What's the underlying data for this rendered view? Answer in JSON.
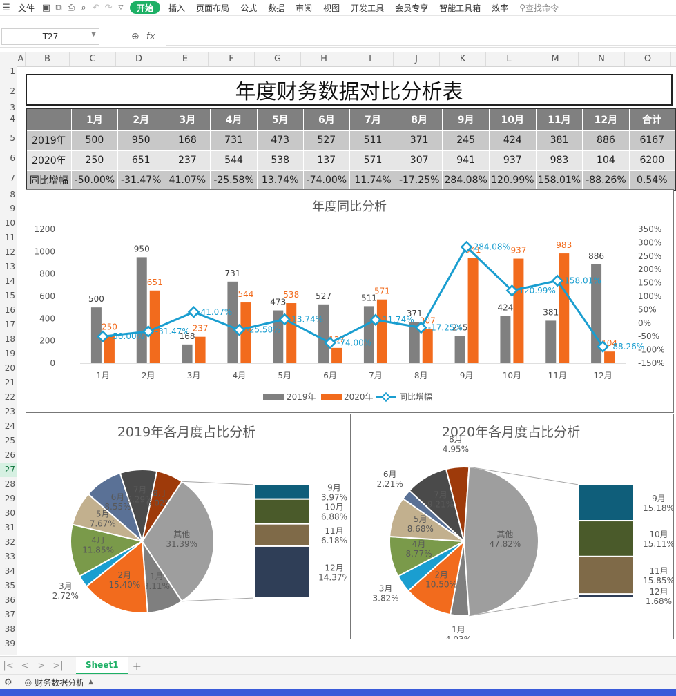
{
  "toolbar": {
    "menu_icon": "hamburger-icon",
    "file_label": "文件",
    "tabs": [
      "开始",
      "插入",
      "页面布局",
      "公式",
      "数据",
      "审阅",
      "视图",
      "开发工具",
      "会员专享",
      "智能工具箱",
      "效率"
    ],
    "active_tab": "开始",
    "search_placeholder": "查找命令"
  },
  "formula_bar": {
    "cell_ref": "T27",
    "fx": "fx",
    "value": ""
  },
  "columns": [
    "A",
    "B",
    "C",
    "D",
    "E",
    "F",
    "G",
    "H",
    "I",
    "J",
    "K",
    "L",
    "M",
    "N",
    "O"
  ],
  "rows": [
    "1",
    "2",
    "3",
    "4",
    "5",
    "6",
    "7",
    "8",
    "9",
    "10",
    "11",
    "12",
    "13",
    "14",
    "15",
    "16",
    "17",
    "18",
    "19",
    "20",
    "21",
    "22",
    "23",
    "24",
    "25",
    "26",
    "27",
    "28",
    "29",
    "30",
    "31",
    "32",
    "33",
    "34",
    "35",
    "36",
    "37",
    "38",
    "39"
  ],
  "active_row": "27",
  "sheet_title": "年度财务数据对比分析表",
  "table": {
    "header": [
      "",
      "1月",
      "2月",
      "3月",
      "4月",
      "5月",
      "6月",
      "7月",
      "8月",
      "9月",
      "10月",
      "11月",
      "12月",
      "合计"
    ],
    "rows": [
      [
        "2019年",
        "500",
        "950",
        "168",
        "731",
        "473",
        "527",
        "511",
        "371",
        "245",
        "424",
        "381",
        "886",
        "6167"
      ],
      [
        "2020年",
        "250",
        "651",
        "237",
        "544",
        "538",
        "137",
        "571",
        "307",
        "941",
        "937",
        "983",
        "104",
        "6200"
      ],
      [
        "同比增幅",
        "-50.00%",
        "-31.47%",
        "41.07%",
        "-25.58%",
        "13.74%",
        "-74.00%",
        "11.74%",
        "-17.25%",
        "284.08%",
        "120.99%",
        "158.01%",
        "-88.26%",
        "0.54%"
      ]
    ]
  },
  "chart_data": [
    {
      "type": "bar",
      "title": "年度同比分析",
      "categories": [
        "1月",
        "2月",
        "3月",
        "4月",
        "5月",
        "6月",
        "7月",
        "8月",
        "9月",
        "10月",
        "11月",
        "12月"
      ],
      "series": [
        {
          "name": "2019年",
          "type": "bar",
          "color": "#808080",
          "values": [
            500,
            950,
            168,
            731,
            473,
            527,
            511,
            371,
            245,
            424,
            381,
            886
          ]
        },
        {
          "name": "2020年",
          "type": "bar",
          "color": "#f26b1d",
          "values": [
            250,
            651,
            237,
            544,
            538,
            137,
            571,
            307,
            941,
            937,
            983,
            104
          ]
        },
        {
          "name": "同比增幅",
          "type": "line",
          "axis": "right",
          "color": "#1a9ed0",
          "values": [
            -50.0,
            -31.47,
            41.07,
            -25.58,
            13.74,
            -74.0,
            11.74,
            -17.25,
            284.08,
            120.99,
            158.01,
            -88.26
          ],
          "labels": [
            "-50.00%",
            "-31.47%",
            "41.07%",
            "-25.58%",
            "13.74%",
            "-74.00%",
            "11.74%",
            "-17.25%",
            "284.08%",
            "120.99%",
            "158.01%",
            "-88.26%"
          ]
        }
      ],
      "ylim": [
        0,
        1200
      ],
      "yticks": [
        "0",
        "200",
        "400",
        "600",
        "800",
        "1000",
        "1200"
      ],
      "y2lim": [
        -150,
        350
      ],
      "y2ticks": [
        "-150%",
        "-100%",
        "-50%",
        "0%",
        "50%",
        "100%",
        "150%",
        "200%",
        "250%",
        "300%",
        "350%"
      ],
      "legend": "bottom",
      "grid": false
    },
    {
      "type": "pie",
      "title": "2019年各月度占比分析",
      "slices": [
        {
          "label": "1月",
          "pct": "8.11%",
          "value": 8.11,
          "color": "#7f7f7f"
        },
        {
          "label": "2月",
          "pct": "15.40%",
          "value": 15.4,
          "color": "#f26b1d"
        },
        {
          "label": "3月",
          "pct": "2.72%",
          "value": 2.72,
          "color": "#1a9ed0"
        },
        {
          "label": "4月",
          "pct": "11.85%",
          "value": 11.85,
          "color": "#7a9a4a"
        },
        {
          "label": "5月",
          "pct": "7.67%",
          "value": 7.67,
          "color": "#c2b08e"
        },
        {
          "label": "6月",
          "pct": "8.55%",
          "value": 8.55,
          "color": "#5a7196"
        },
        {
          "label": "7月",
          "pct": "8.29%",
          "value": 8.29,
          "color": "#4a4a4a"
        },
        {
          "label": "8月",
          "pct": "6.02%",
          "value": 6.02,
          "color": "#9e3a0a"
        },
        {
          "label": "其他",
          "pct": "31.39%",
          "value": 31.39,
          "color": "#9e9e9e"
        }
      ],
      "breakout": [
        {
          "label": "9月",
          "pct": "3.97%",
          "value": 3.97,
          "color": "#0f5e7a"
        },
        {
          "label": "10月",
          "pct": "6.88%",
          "value": 6.88,
          "color": "#4a5a2a"
        },
        {
          "label": "11月",
          "pct": "6.18%",
          "value": 6.18,
          "color": "#7f6a48"
        },
        {
          "label": "12月",
          "pct": "14.37%",
          "value": 14.37,
          "color": "#2f3e57"
        }
      ]
    },
    {
      "type": "pie",
      "title": "2020年各月度占比分析",
      "slices": [
        {
          "label": "1月",
          "pct": "4.03%",
          "value": 4.03,
          "color": "#7f7f7f"
        },
        {
          "label": "2月",
          "pct": "10.50%",
          "value": 10.5,
          "color": "#f26b1d"
        },
        {
          "label": "3月",
          "pct": "3.82%",
          "value": 3.82,
          "color": "#1a9ed0"
        },
        {
          "label": "4月",
          "pct": "8.77%",
          "value": 8.77,
          "color": "#7a9a4a"
        },
        {
          "label": "5月",
          "pct": "8.68%",
          "value": 8.68,
          "color": "#c2b08e"
        },
        {
          "label": "6月",
          "pct": "2.21%",
          "value": 2.21,
          "color": "#5a7196"
        },
        {
          "label": "7月",
          "pct": "9.21%",
          "value": 9.21,
          "color": "#4a4a4a"
        },
        {
          "label": "8月",
          "pct": "4.95%",
          "value": 4.95,
          "color": "#9e3a0a"
        },
        {
          "label": "其他",
          "pct": "47.82%",
          "value": 47.82,
          "color": "#9e9e9e"
        }
      ],
      "breakout": [
        {
          "label": "9月",
          "pct": "15.18%",
          "value": 15.18,
          "color": "#0f5e7a"
        },
        {
          "label": "10月",
          "pct": "15.11%",
          "value": 15.11,
          "color": "#4a5a2a"
        },
        {
          "label": "11月",
          "pct": "15.85%",
          "value": 15.85,
          "color": "#7f6a48"
        },
        {
          "label": "12月",
          "pct": "1.68%",
          "value": 1.68,
          "color": "#2f3e57"
        }
      ]
    }
  ],
  "sheet_tabs": {
    "active": "Sheet1",
    "add": "+"
  },
  "status": {
    "doc_name": "财务数据分析"
  }
}
